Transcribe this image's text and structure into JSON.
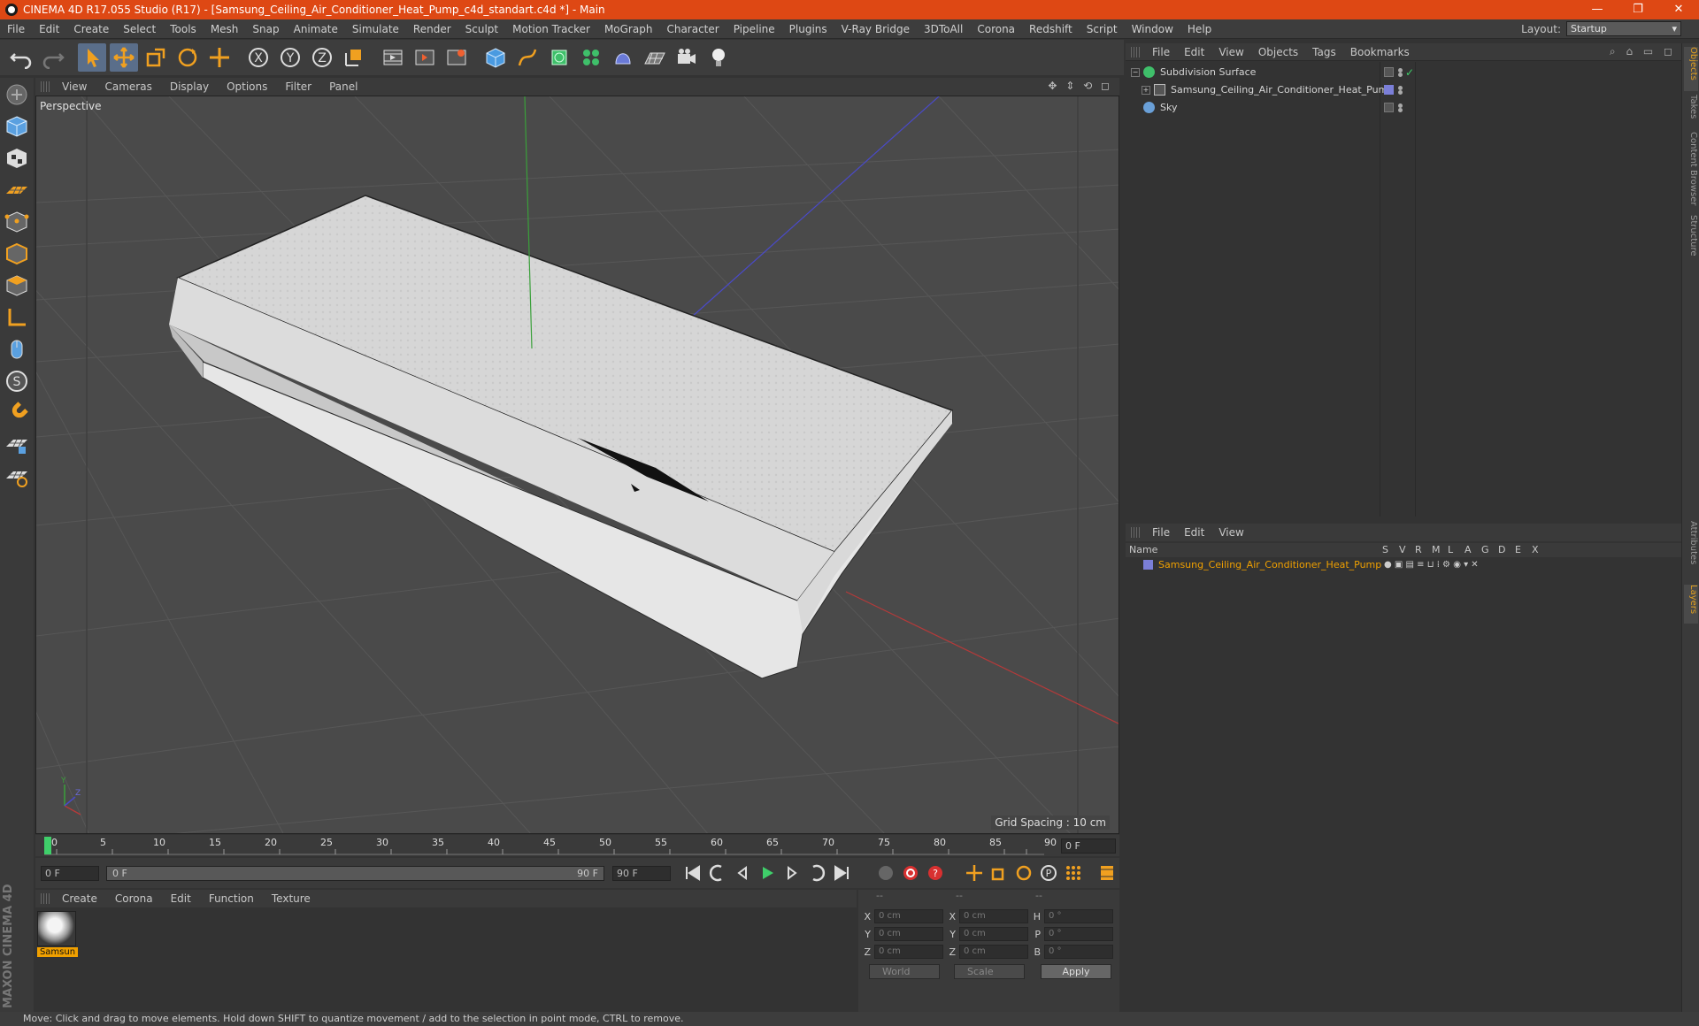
{
  "titlebar": {
    "title": "CINEMA 4D R17.055 Studio (R17) - [Samsung_Ceiling_Air_Conditioner_Heat_Pump_c4d_standart.c4d *] - Main",
    "minimize": "—",
    "restore": "❐",
    "close": "✕"
  },
  "menubar": {
    "items": [
      "File",
      "Edit",
      "Create",
      "Select",
      "Tools",
      "Mesh",
      "Snap",
      "Animate",
      "Simulate",
      "Render",
      "Sculpt",
      "Motion Tracker",
      "MoGraph",
      "Character",
      "Pipeline",
      "Plugins",
      "V-Ray Bridge",
      "3DToAll",
      "Corona",
      "Redshift",
      "Script",
      "Window",
      "Help"
    ],
    "layout_label": "Layout:",
    "layout_value": "Startup"
  },
  "viewport": {
    "menu": [
      "View",
      "Cameras",
      "Display",
      "Options",
      "Filter",
      "Panel"
    ],
    "nav_icons": "✥ ⇕ ⟲ ◻",
    "label": "Perspective",
    "grid_spacing": "Grid Spacing : 10 cm",
    "accent_x": "#b43a3a",
    "accent_y": "#3aa03a",
    "accent_z": "#4a4ac8"
  },
  "timeline": {
    "ticks": [
      "0",
      "5",
      "10",
      "15",
      "20",
      "25",
      "30",
      "35",
      "40",
      "45",
      "50",
      "55",
      "60",
      "65",
      "70",
      "75",
      "80",
      "85",
      "90"
    ],
    "current_frame": "0 F"
  },
  "transport": {
    "start_field": "0 F",
    "range_start": "0 F",
    "range_end": "90 F",
    "end_field": "90 F"
  },
  "material_manager": {
    "menu": [
      "Create",
      "Corona",
      "Edit",
      "Function",
      "Texture"
    ],
    "material_name": "Samsun"
  },
  "coordinates": {
    "headers": [
      "--",
      "--",
      "--"
    ],
    "rows": [
      {
        "a1": "X",
        "v1": "0 cm",
        "a2": "X",
        "v2": "0 cm",
        "a3": "H",
        "v3": "0 °"
      },
      {
        "a1": "Y",
        "v1": "0 cm",
        "a2": "Y",
        "v2": "0 cm",
        "a3": "P",
        "v3": "0 °"
      },
      {
        "a1": "Z",
        "v1": "0 cm",
        "a2": "Z",
        "v2": "0 cm",
        "a3": "B",
        "v3": "0 °"
      }
    ],
    "world_select": "World",
    "scale_select": "Scale",
    "apply_label": "Apply"
  },
  "object_manager": {
    "menu": [
      "File",
      "Edit",
      "View",
      "Objects",
      "Tags",
      "Bookmarks"
    ],
    "objects": [
      {
        "name": "Subdivision Surface",
        "icon_color": "#3fbf6a"
      },
      {
        "name": "Samsung_Ceiling_Air_Conditioner_Heat_Pump",
        "icon_color": "#c8c8c8"
      },
      {
        "name": "Sky",
        "icon_color": "#6aa0d8"
      }
    ]
  },
  "layer_manager": {
    "menu": [
      "File",
      "Edit",
      "View"
    ],
    "columns": [
      "Name",
      "S",
      "V",
      "R",
      "M",
      "L",
      "A",
      "G",
      "D",
      "E",
      "X"
    ],
    "layers": [
      {
        "name": "Samsung_Ceiling_Air_Conditioner_Heat_Pump",
        "color": "#7b7fd8"
      }
    ]
  },
  "side_tabs": [
    "Objects",
    "Takes",
    "Content Browser",
    "Structure",
    "Attributes",
    "Layers"
  ],
  "statusbar": {
    "text": "Move: Click and drag to move elements. Hold down SHIFT to quantize movement / add to the selection in point mode, CTRL to remove."
  },
  "logo": {
    "text": "MAXON CINEMA 4D"
  }
}
